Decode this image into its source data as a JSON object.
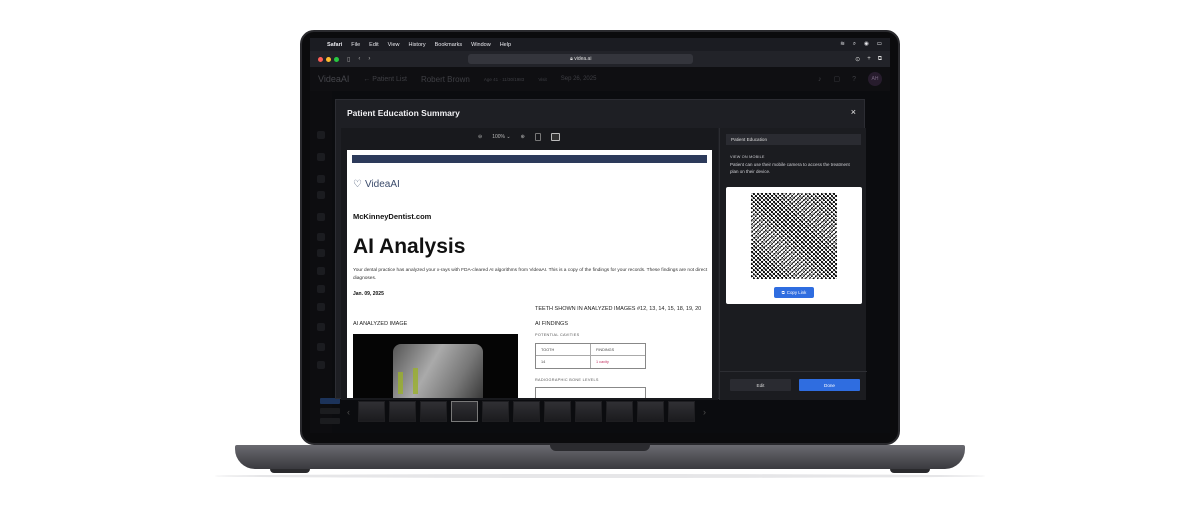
{
  "menubar": {
    "items": [
      "Safari",
      "File",
      "Edit",
      "View",
      "History",
      "Bookmarks",
      "Window",
      "Help"
    ]
  },
  "browser": {
    "url": "videa.ai"
  },
  "app": {
    "logo": "VideaAI",
    "back_label": "← Patient List",
    "patient_name": "Robert Brown",
    "patient_meta": "Age 41 · 11/30/1983 ",
    "visit_label": "Visit",
    "visit_date": "Sep 26, 2025",
    "avatar_initials": "AH"
  },
  "modal": {
    "title": "Patient Education Summary",
    "close_icon": "×",
    "zoom_level": "100%"
  },
  "document": {
    "logo": "VideaAI",
    "site": "McKinneyDentist.com",
    "heading": "AI Analysis",
    "intro": "Your dental practice has analyzed your x-rays with FDA-cleared AI algorithms from VideaAI. This is a copy of the findings for your records. These findings are not direct diagnoses.",
    "date": "Jan. 09, 2025",
    "teeth_shown": "TEETH SHOWN IN ANALYZED IMAGES #12, 13, 14, 15, 18, 19, 20",
    "ai_image_label": "AI ANALYZED IMAGE",
    "ai_findings_label": "AI FINDINGS",
    "potential_cavities_label": "POTENTIAL CAVITIES",
    "table_headers": [
      "TOOTH",
      "FINDINGS"
    ],
    "table_rows": [
      [
        "14",
        "1 cavity"
      ]
    ],
    "bone_levels_label": "RADIOGRAPHIC BONE LEVELS"
  },
  "panel": {
    "header": "Patient Education",
    "view_on_mobile": "VIEW ON MOBILE",
    "description": "Patient can use their mobile camera to access the treatment plan on their device.",
    "copy_link": "Copy Link",
    "edit": "Edit",
    "done": "Done"
  },
  "colors": {
    "primary_blue": "#2f6de0",
    "doc_header_bar": "#2c3a5a",
    "finding_flag": "#c03060"
  }
}
